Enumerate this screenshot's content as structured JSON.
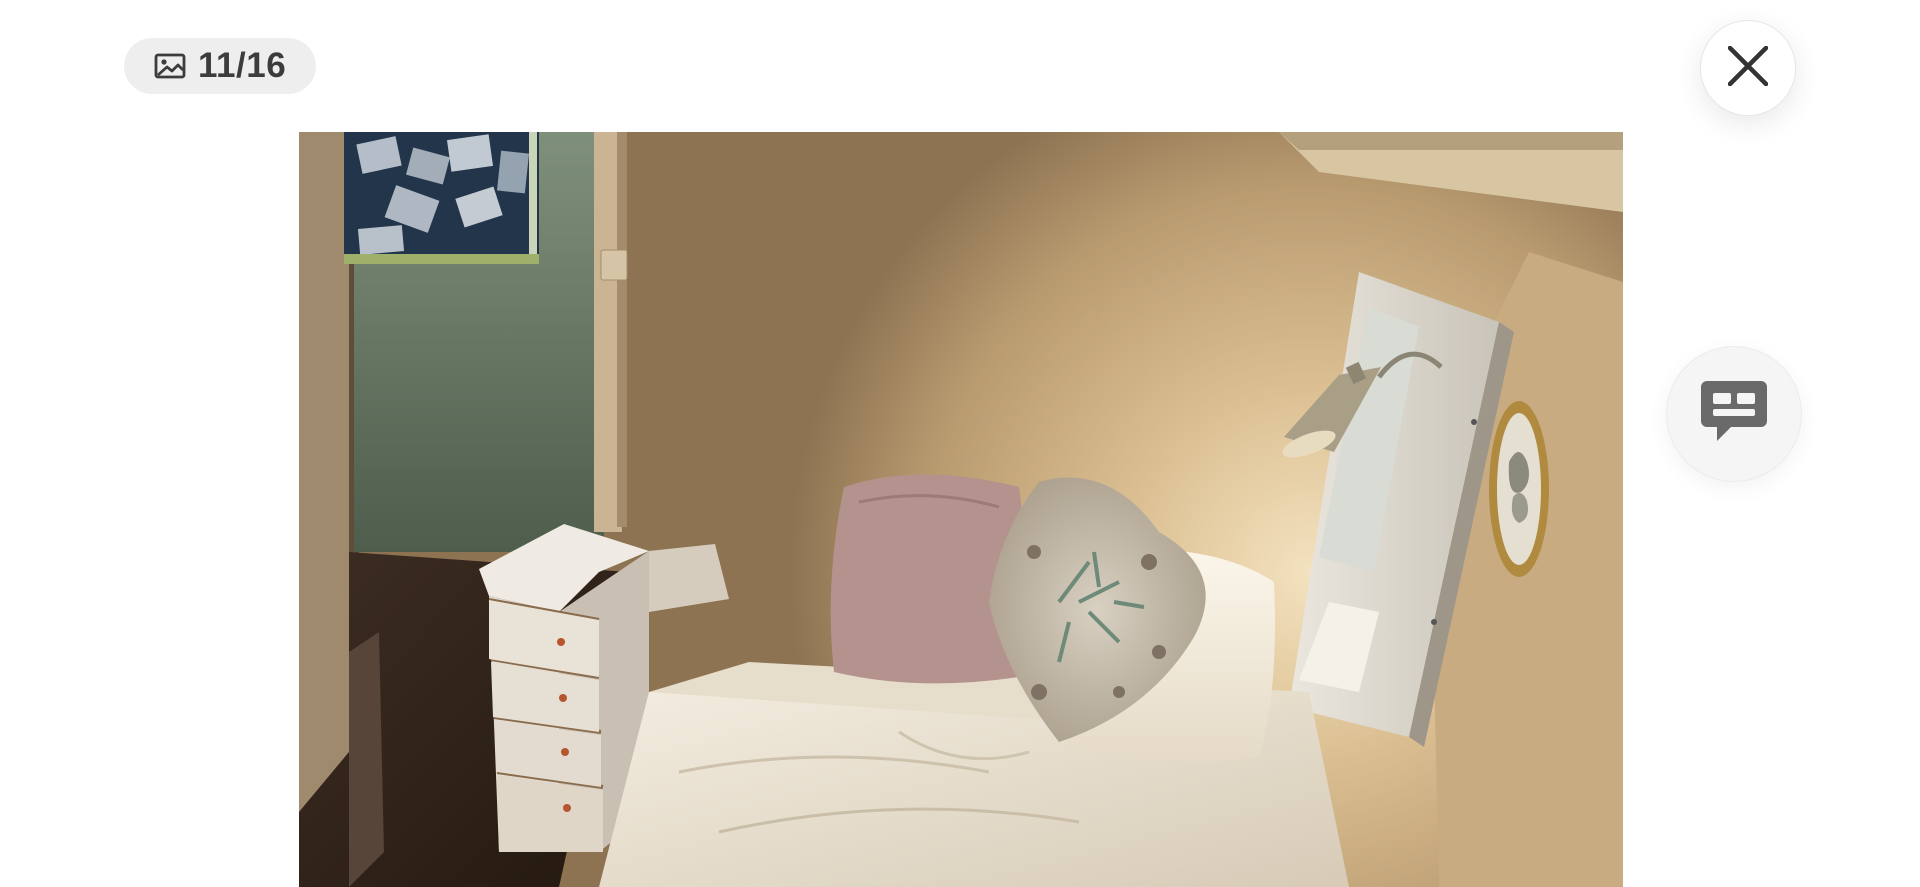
{
  "gallery": {
    "counter": "11/16",
    "counter_icon": "image-icon",
    "close_icon": "close-icon",
    "chat_icon": "chat-bubble-icon"
  },
  "photo": {
    "subject": "bedroom"
  },
  "colors": {
    "pill_background": "#eeeeee",
    "counter_text": "#3c3c3c",
    "icon": "#3c3c3c",
    "chat_icon": "#6a6a6a"
  }
}
